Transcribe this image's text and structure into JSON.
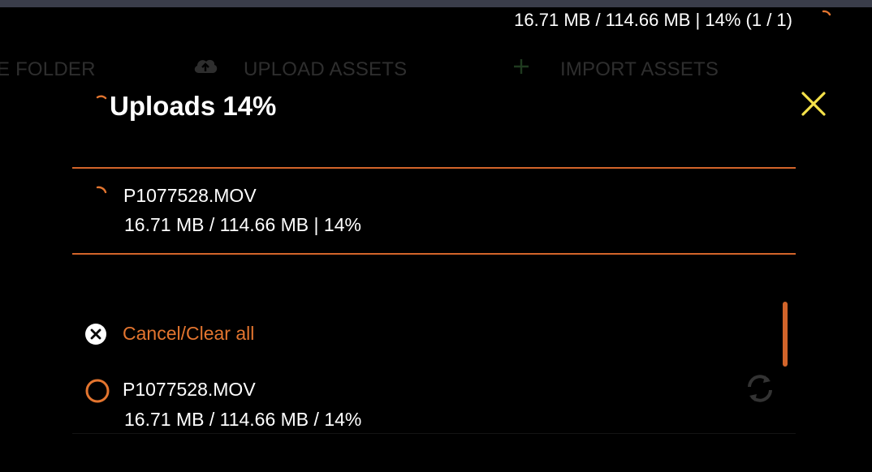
{
  "status_bar": {
    "summary": "16.71 MB / 114.66 MB | 14% (1 / 1)"
  },
  "background_toolbar": {
    "items": [
      {
        "label": "E FOLDER"
      },
      {
        "label": "UPLOAD ASSETS",
        "icon": "cloud-upload-icon"
      },
      {
        "label": "IMPORT ASSETS",
        "icon": "plus-icon"
      }
    ]
  },
  "dialog": {
    "title": "Uploads 14%",
    "close_icon": "close-icon",
    "current_upload": {
      "file_name": "P1077528.MOV",
      "progress_text": "16.71 MB / 114.66 MB | 14%",
      "progress_fraction": 0.14
    },
    "cancel_label": "Cancel/Clear all",
    "queue": [
      {
        "file_name": "P1077528.MOV",
        "progress_text": "16.71 MB / 114.66 MB / 14%"
      }
    ]
  },
  "colors": {
    "accent": "#e3752f",
    "divider": "#d2642a",
    "close": "#f5e24a",
    "background": "#000000"
  }
}
